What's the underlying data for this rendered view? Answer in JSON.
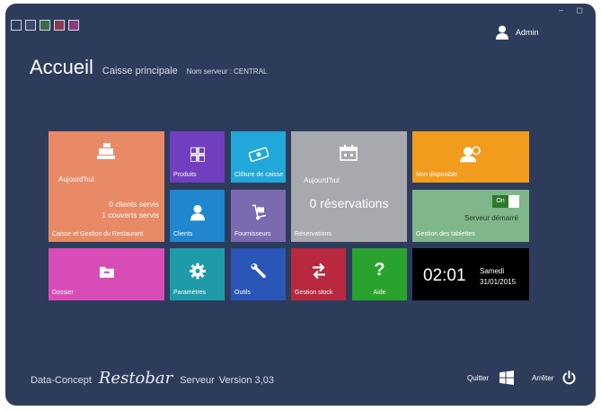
{
  "window": {
    "controls": "– ◻"
  },
  "swatches": [
    "#2e3c5c",
    "#3a4a6e",
    "#3e6a4a",
    "#8a3a52",
    "#8a3a7e"
  ],
  "user": {
    "name": "Admin"
  },
  "header": {
    "title": "Accueil",
    "subtitle": "Caisse principale",
    "server": "Nom serveur : CENTRAL"
  },
  "tiles": {
    "caisse": {
      "today": "Aujourd'hui",
      "clients": "0 clients servis",
      "couverts": "1 couverts servis",
      "label": "Caisse et Gestion du Restaurant",
      "color": "#e98a67"
    },
    "produits": {
      "label": "Produits",
      "color": "#6f3fc0"
    },
    "cloture": {
      "label": "Clôture de caisse",
      "color": "#22a8d8"
    },
    "reservations": {
      "today": "Aujourd'hui",
      "count": "0 réservations",
      "label": "Réservations",
      "color": "#a7a9ae"
    },
    "nondispo": {
      "label": "Non disponible",
      "color": "#f29c1e"
    },
    "clients": {
      "label": "Clients",
      "color": "#1f86cf"
    },
    "fournisseurs": {
      "label": "Fournisseurs",
      "color": "#7a6bb0"
    },
    "tablettes": {
      "toggle": "On",
      "status": "Serveur démarré",
      "label": "Gestion des tablettes",
      "color": "#7fb68a"
    },
    "dossier": {
      "label": "Dossier",
      "color": "#d84cb8"
    },
    "parametres": {
      "label": "Paramètres",
      "color": "#1f9aa8"
    },
    "outils": {
      "label": "Outils",
      "color": "#2a56b8"
    },
    "stock": {
      "label": "Gestion stock",
      "color": "#b8283e"
    },
    "aide": {
      "label": "Aide",
      "color": "#2aa32e"
    },
    "clock": {
      "time": "02:01",
      "day": "Samedi",
      "date": "31/01/2015",
      "color": "#000000"
    }
  },
  "footer": {
    "company": "Data-Concept",
    "product": "Restobar",
    "edition": "Serveur",
    "version": "Version 3,03",
    "quit": "Quitter",
    "stop": "Arrêter"
  },
  "icons": [
    "user-icon",
    "cash-register-icon",
    "grid-icon",
    "money-icon",
    "calendar-icon",
    "support-agent-icon",
    "person-icon",
    "dolly-icon",
    "folder-icon",
    "gear-icon",
    "wrench-icon",
    "swap-arrows-icon",
    "question-icon",
    "windows-logo-icon",
    "power-icon"
  ]
}
